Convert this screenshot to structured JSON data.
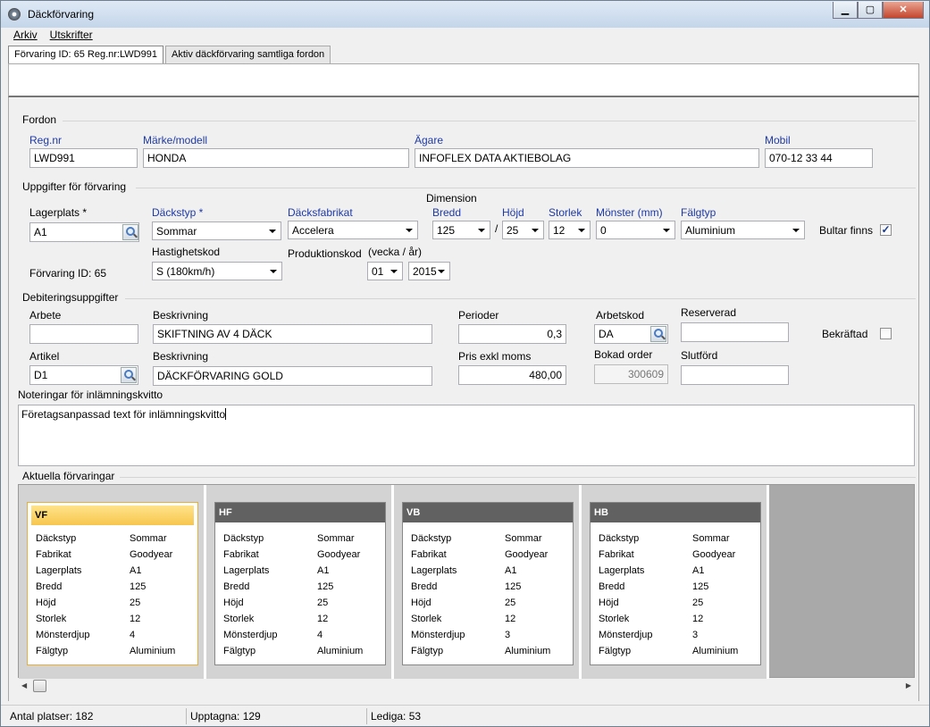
{
  "window": {
    "title": "Däckförvaring",
    "min_glyph": "▁",
    "max_glyph": "▢",
    "close_glyph": "✕"
  },
  "menu": {
    "arkiv": "Arkiv",
    "utskrifter": "Utskrifter"
  },
  "tabs": [
    {
      "label": "Förvaring ID: 65 Reg.nr:LWD991"
    },
    {
      "label": "Aktiv däckförvaring samtliga fordon"
    }
  ],
  "fordon": {
    "legend": "Fordon",
    "regnr_label": "Reg.nr",
    "regnr_value": "LWD991",
    "marke_label": "Märke/modell",
    "marke_value": "HONDA",
    "agare_label": "Ägare",
    "agare_value": "INFOFLEX DATA AKTIEBOLAG",
    "mobil_label": "Mobil",
    "mobil_value": "070-12 33 44"
  },
  "forvaring": {
    "legend": "Uppgifter för förvaring",
    "lagerplats_label": "Lagerplats *",
    "lagerplats_value": "A1",
    "forvaring_id": "Förvaring ID: 65",
    "dackstyp_label": "Däckstyp *",
    "dackstyp_value": "Sommar",
    "dacksfabrikat_label": "Däcksfabrikat",
    "dacksfabrikat_value": "Accelera",
    "dimension_label": "Dimension",
    "bredd_label": "Bredd",
    "bredd_value": "125",
    "slash": "/",
    "hojd_label": "Höjd",
    "hojd_value": "25",
    "storlek_label": "Storlek",
    "storlek_value": "12",
    "monster_label": "Mönster (mm)",
    "monster_value": "0",
    "falgtyp_label": "Fälgtyp",
    "falgtyp_value": "Aluminium",
    "bultar_label": "Bultar finns",
    "bultar_checked": "✓",
    "hastighet_label": "Hastighetskod",
    "hastighet_value": "S (180km/h)",
    "produktion_label": "Produktionskod",
    "vecka_ar_label": "(vecka  /   år)",
    "vecka_value": "01",
    "ar_value": "2015"
  },
  "debitering": {
    "legend": "Debiteringsuppgifter",
    "arbete_label": "Arbete",
    "arbete_value": "",
    "beskrivning1_label": "Beskrivning",
    "beskrivning1_value": "SKIFTNING AV 4 DÄCK",
    "perioder_label": "Perioder",
    "perioder_value": "0,3",
    "arbetskod_label": "Arbetskod",
    "arbetskod_value": "DA",
    "reserverad_label": "Reserverad",
    "reserverad_value": "",
    "bekraftad_label": "Bekräftad",
    "artikel_label": "Artikel",
    "artikel_value": "D1",
    "beskrivning2_label": "Beskrivning",
    "beskrivning2_value": "DÄCKFÖRVARING GOLD",
    "pris_label": "Pris exkl moms",
    "pris_value": "480,00",
    "bokad_label": "Bokad order",
    "bokad_value": "300609",
    "slutford_label": "Slutförd",
    "slutford_value": ""
  },
  "noteringar": {
    "label": "Noteringar för inlämningskvitto",
    "text": "Företagsanpassad text för inlämningskvitto"
  },
  "aktuella": {
    "legend": "Aktuella förvaringar",
    "row_labels": [
      "Däckstyp",
      "Fabrikat",
      "Lagerplats",
      "Bredd",
      "Höjd",
      "Storlek",
      "Mönsterdjup",
      "Fälgtyp"
    ],
    "cards": [
      {
        "code": "VF",
        "values": [
          "Sommar",
          "Goodyear",
          "A1",
          "125",
          "25",
          "12",
          "4",
          "Aluminium"
        ]
      },
      {
        "code": "HF",
        "values": [
          "Sommar",
          "Goodyear",
          "A1",
          "125",
          "25",
          "12",
          "4",
          "Aluminium"
        ]
      },
      {
        "code": "VB",
        "values": [
          "Sommar",
          "Goodyear",
          "A1",
          "125",
          "25",
          "12",
          "3",
          "Aluminium"
        ]
      },
      {
        "code": "HB",
        "values": [
          "Sommar",
          "Goodyear",
          "A1",
          "125",
          "25",
          "12",
          "3",
          "Aluminium"
        ]
      }
    ]
  },
  "status": {
    "antal": "Antal platser: 182",
    "upptagna": "Upptagna: 129",
    "lediga": "Lediga: 53"
  },
  "colors": {
    "label_blue": "#1f3aa6",
    "selected_card": "#f7c64d",
    "card_header": "#616161"
  }
}
